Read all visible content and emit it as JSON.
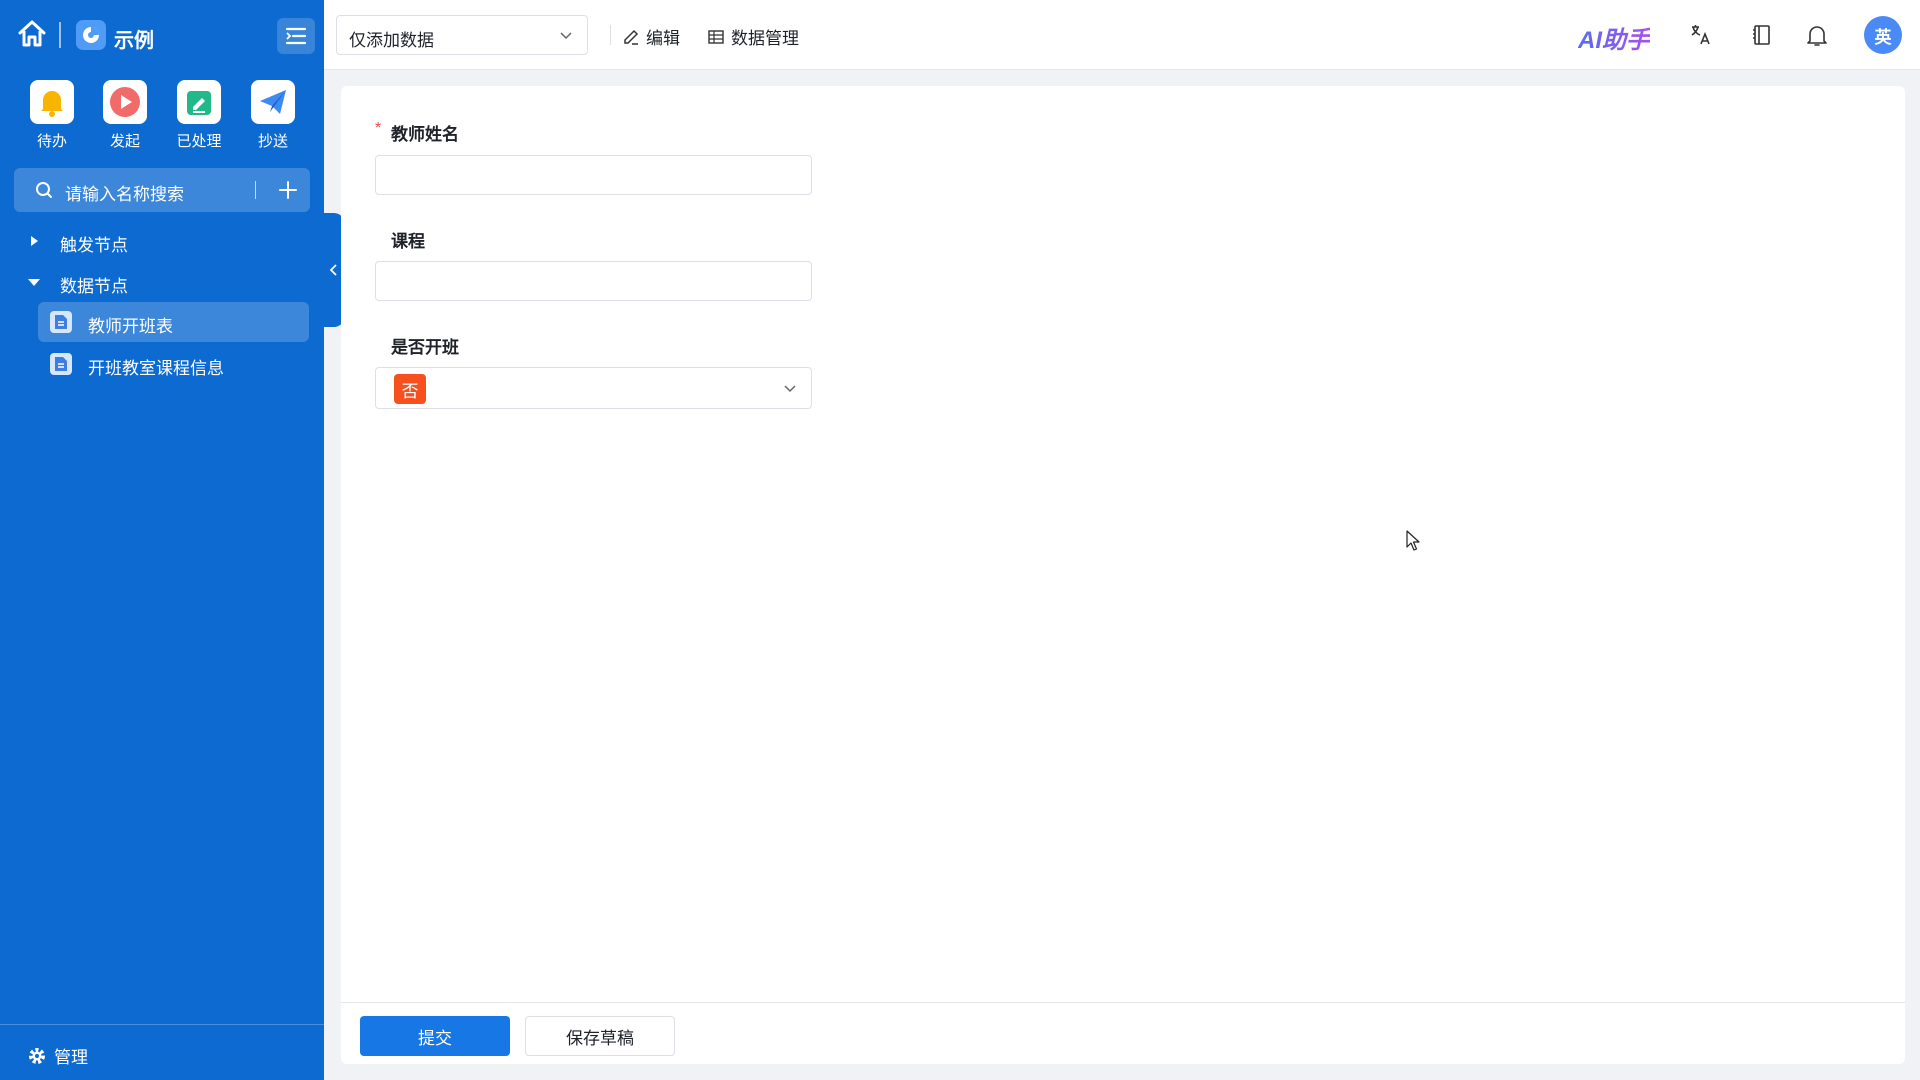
{
  "app": {
    "name": "示例"
  },
  "quick_actions": [
    {
      "label": "待办",
      "icon": "bell-icon",
      "color": "#f7b500"
    },
    {
      "label": "发起",
      "icon": "play-icon",
      "color": "#f26b6b"
    },
    {
      "label": "已处理",
      "icon": "check-edit-icon",
      "color": "#22b88a"
    },
    {
      "label": "抄送",
      "icon": "send-icon",
      "color": "#3d8bf2"
    }
  ],
  "search": {
    "placeholder": "请输入名称搜索"
  },
  "tree": {
    "groups": [
      {
        "label": "触发节点",
        "expanded": false,
        "children": []
      },
      {
        "label": "数据节点",
        "expanded": true,
        "children": [
          {
            "label": "教师开班表",
            "active": true
          },
          {
            "label": "开班教室课程信息",
            "active": false
          }
        ]
      }
    ]
  },
  "footer": {
    "manage_label": "管理"
  },
  "toolbar": {
    "view_select": "仅添加数据",
    "edit_label": "编辑",
    "data_manage_label": "数据管理",
    "ai_label": "AI助手",
    "avatar_text": "英"
  },
  "form": {
    "fields": [
      {
        "label": "教师姓名",
        "required": true,
        "type": "text",
        "value": ""
      },
      {
        "label": "课程",
        "required": false,
        "type": "text",
        "value": ""
      },
      {
        "label": "是否开班",
        "required": false,
        "type": "select",
        "value": "否"
      }
    ],
    "submit_label": "提交",
    "draft_label": "保存草稿"
  },
  "colors": {
    "sidebar": "#0c6ad1",
    "primary": "#1677e5",
    "tag_no": "#f5501e"
  }
}
